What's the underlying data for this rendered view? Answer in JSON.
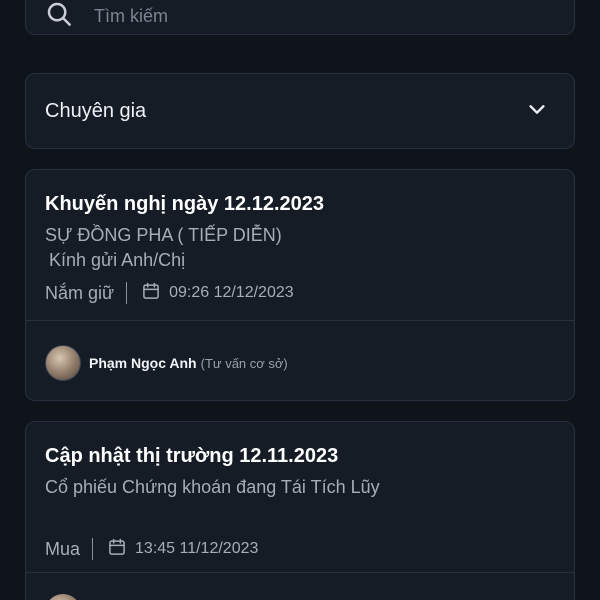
{
  "search": {
    "placeholder": "Tìm kiếm"
  },
  "filter": {
    "selected": "Chuyên gia"
  },
  "icons": {
    "search": "search-icon",
    "chevron": "chevron-down-icon",
    "calendar": "calendar-icon"
  },
  "posts": [
    {
      "title": "Khuyến nghị ngày 12.12.2023",
      "subtitle": "SỰ ĐỒNG PHA ( TIẾP DIỄN)",
      "subtitle2": "Kính gửi Anh/Chị",
      "action": "Nắm giữ",
      "timestamp": "09:26 12/12/2023",
      "author": "Phạm Ngọc Anh",
      "role": "(Tư vấn cơ sở)"
    },
    {
      "title": "Cập nhật thị trường 12.11.2023",
      "subtitle": "Cổ phiếu Chứng khoán đang Tái Tích Lũy",
      "action": "Mua",
      "timestamp": "13:45 11/12/2023"
    }
  ],
  "colors": {
    "background": "#0f141b",
    "card": "#161c25",
    "border": "#263041",
    "muted_text": "#a7adb8"
  }
}
